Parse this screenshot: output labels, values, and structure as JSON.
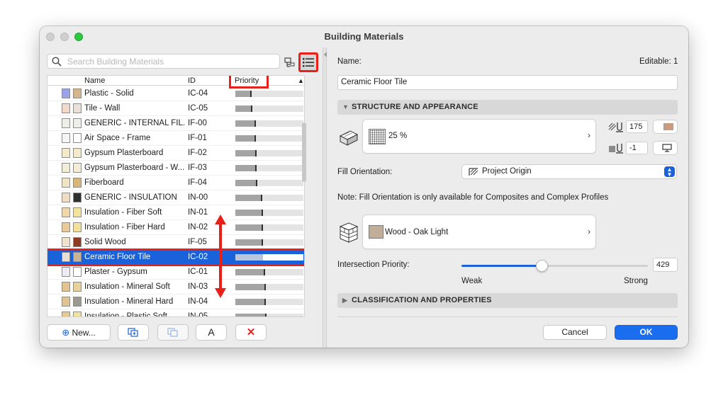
{
  "window": {
    "title": "Building Materials"
  },
  "search": {
    "placeholder": "Search Building Materials"
  },
  "table": {
    "headers": {
      "name": "Name",
      "id": "ID",
      "priority": "Priority"
    },
    "rows": [
      {
        "name": "Plastic - Solid",
        "id": "IC-04",
        "priority": 0.24,
        "color1": "#9aa3e8",
        "color2": "#d6b58c"
      },
      {
        "name": "Tile - Wall",
        "id": "IC-05",
        "priority": 0.25,
        "color1": "#f3d9cc",
        "color2": "#e9e1d7"
      },
      {
        "name": "GENERIC - INTERNAL FIL...",
        "id": "IF-00",
        "priority": 0.3,
        "color1": "#f0eee8",
        "color2": "#f0eee8"
      },
      {
        "name": "Air Space - Frame",
        "id": "IF-01",
        "priority": 0.3,
        "color1": "#f5f5f5",
        "color2": "#ffffff"
      },
      {
        "name": "Gypsum Plasterboard",
        "id": "IF-02",
        "priority": 0.31,
        "color1": "#f4e9c9",
        "color2": "#f4e9c9"
      },
      {
        "name": "Gypsum Plasterboard - W...",
        "id": "IF-03",
        "priority": 0.31,
        "color1": "#f3ecd6",
        "color2": "#f3ecd6"
      },
      {
        "name": "Fiberboard",
        "id": "IF-04",
        "priority": 0.32,
        "color1": "#f0e4c4",
        "color2": "#d8b67a"
      },
      {
        "name": "GENERIC - INSULATION",
        "id": "IN-00",
        "priority": 0.4,
        "color1": "#f0ddc6",
        "color2": "#2f2f2f"
      },
      {
        "name": "Insulation - Fiber Soft",
        "id": "IN-01",
        "priority": 0.41,
        "color1": "#f0d7a8",
        "color2": "#f3e39b"
      },
      {
        "name": "Insulation - Fiber Hard",
        "id": "IN-02",
        "priority": 0.41,
        "color1": "#e9c998",
        "color2": "#f2df9b"
      },
      {
        "name": "Solid Wood",
        "id": "IF-05",
        "priority": 0.41,
        "color1": "#efe3cf",
        "color2": "#8e3b24"
      },
      {
        "name": "Ceramic Floor Tile",
        "id": "IC-02",
        "priority": 0.43,
        "color1": "#e9dfd4",
        "color2": "#c9b49a"
      },
      {
        "name": "Plaster - Gypsum",
        "id": "IC-01",
        "priority": 0.44,
        "color1": "#ecedf4",
        "color2": "#ffffff"
      },
      {
        "name": "Insulation - Mineral Soft",
        "id": "IN-03",
        "priority": 0.45,
        "color1": "#e3c48e",
        "color2": "#e6d29a"
      },
      {
        "name": "Insulation - Mineral Hard",
        "id": "IN-04",
        "priority": 0.45,
        "color1": "#e0c392",
        "color2": "#9a9a90"
      },
      {
        "name": "Insulation - Plastic Soft",
        "id": "IN-05",
        "priority": 0.46,
        "color1": "#e6c98f",
        "color2": "#efe29e"
      }
    ],
    "selected_index": 11
  },
  "bottom_buttons": {
    "new_label": "New...",
    "rename_glyph": "A",
    "delete_glyph": "✕"
  },
  "details": {
    "name_label": "Name:",
    "editable_label": "Editable: 1",
    "name_value": "Ceramic Floor Tile",
    "structure_section": "STRUCTURE AND APPEARANCE",
    "fill_percent": "25 %",
    "pen_value_1": "175",
    "pen_value_2": "-1",
    "fill_orientation_label": "Fill Orientation:",
    "fill_orientation_value": "Project Origin",
    "note": "Note: Fill Orientation is only available for Composites and Complex Profiles",
    "surface_name": "Wood - Oak Light",
    "intersection_priority_label": "Intersection Priority:",
    "intersection_priority_value": "429",
    "intersection_priority_fraction": 0.43,
    "weak_label": "Weak",
    "strong_label": "Strong",
    "classification_section": "CLASSIFICATION AND PROPERTIES"
  },
  "actions": {
    "cancel": "Cancel",
    "ok": "OK"
  },
  "colors": {
    "accent": "#1a62d9",
    "highlight": "#e8201a",
    "surface_swatch": "#c1ad98"
  }
}
